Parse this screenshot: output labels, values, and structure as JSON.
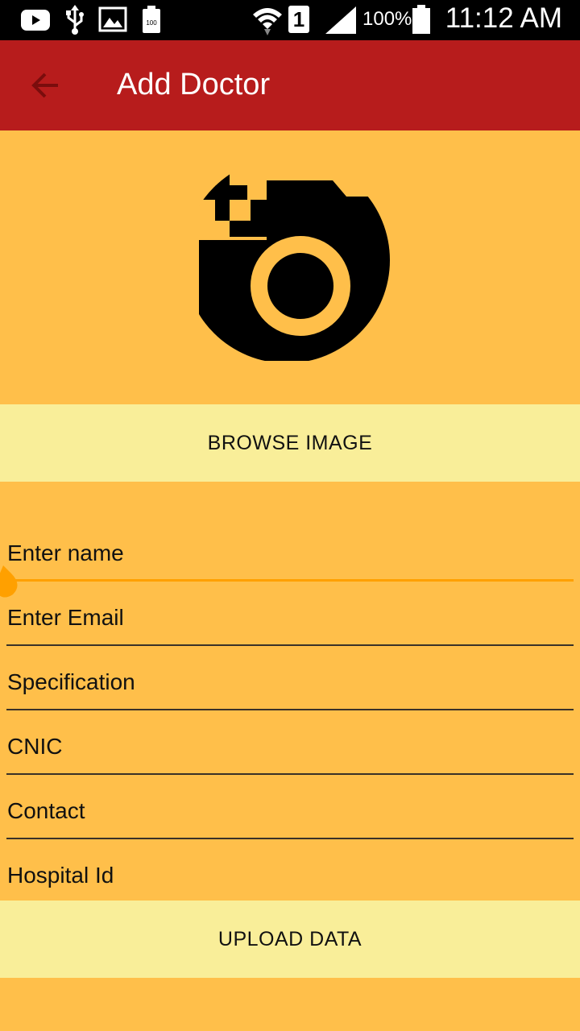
{
  "status_bar": {
    "battery_percent": "100%",
    "sim_slot": "1",
    "time": "11:12 AM",
    "battery_saver_label": "100"
  },
  "app_bar": {
    "title": "Add Doctor"
  },
  "image_picker": {
    "icon": "add-a-photo-icon"
  },
  "buttons": {
    "browse": "BROWSE IMAGE",
    "upload": "UPLOAD DATA"
  },
  "form": {
    "name": {
      "placeholder": "Enter name",
      "value": ""
    },
    "email": {
      "placeholder": "Enter Email",
      "value": ""
    },
    "specification": {
      "placeholder": "Specification",
      "value": ""
    },
    "cnic": {
      "placeholder": "CNIC",
      "value": ""
    },
    "contact": {
      "placeholder": "Contact",
      "value": ""
    },
    "hospital_id": {
      "placeholder": "Hospital Id",
      "value": ""
    }
  },
  "colors": {
    "background": "#FFBF4A",
    "app_bar": "#B71C1C",
    "button": "#F9EE99",
    "focus_accent": "#FFA000"
  }
}
